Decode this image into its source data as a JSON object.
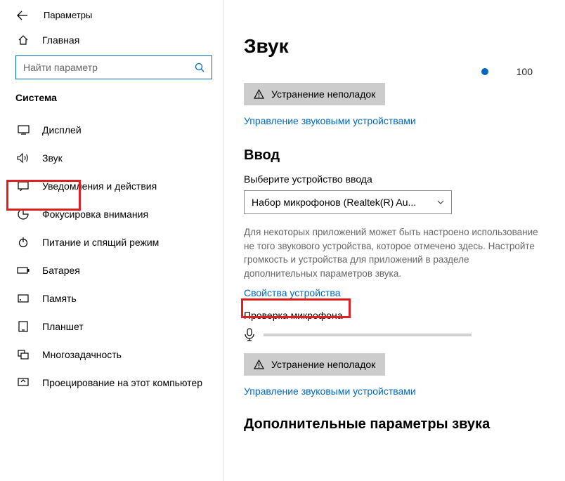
{
  "window_title": "Параметры",
  "home_label": "Главная",
  "search_placeholder": "Найти параметр",
  "section_label": "Система",
  "nav": [
    {
      "key": "display",
      "label": "Дисплей"
    },
    {
      "key": "sound",
      "label": "Звук"
    },
    {
      "key": "notifications",
      "label": "Уведомления и действия"
    },
    {
      "key": "focus",
      "label": "Фокусировка внимания"
    },
    {
      "key": "power",
      "label": "Питание и спящий режим"
    },
    {
      "key": "battery",
      "label": "Батарея"
    },
    {
      "key": "storage",
      "label": "Память"
    },
    {
      "key": "tablet",
      "label": "Планшет"
    },
    {
      "key": "multitask",
      "label": "Многозадачность"
    },
    {
      "key": "project",
      "label": "Проецирование на этот компьютер"
    }
  ],
  "page_title": "Звук",
  "volume_value": "100",
  "troubleshoot_label": "Устранение неполадок",
  "manage_devices_link": "Управление звуковыми устройствами",
  "input_heading": "Ввод",
  "input_choose_label": "Выберите устройство ввода",
  "input_selected": "Набор микрофонов (Realtek(R) Au...",
  "input_help": "Для некоторых приложений может быть настроено использование не того звукового устройства, которое отмечено здесь. Настройте громкость и устройства для приложений в разделе дополнительных параметров звука.",
  "device_props_link": "Свойства устройства",
  "mic_check_label": "Проверка микрофона",
  "additional_heading": "Дополнительные параметры звука"
}
